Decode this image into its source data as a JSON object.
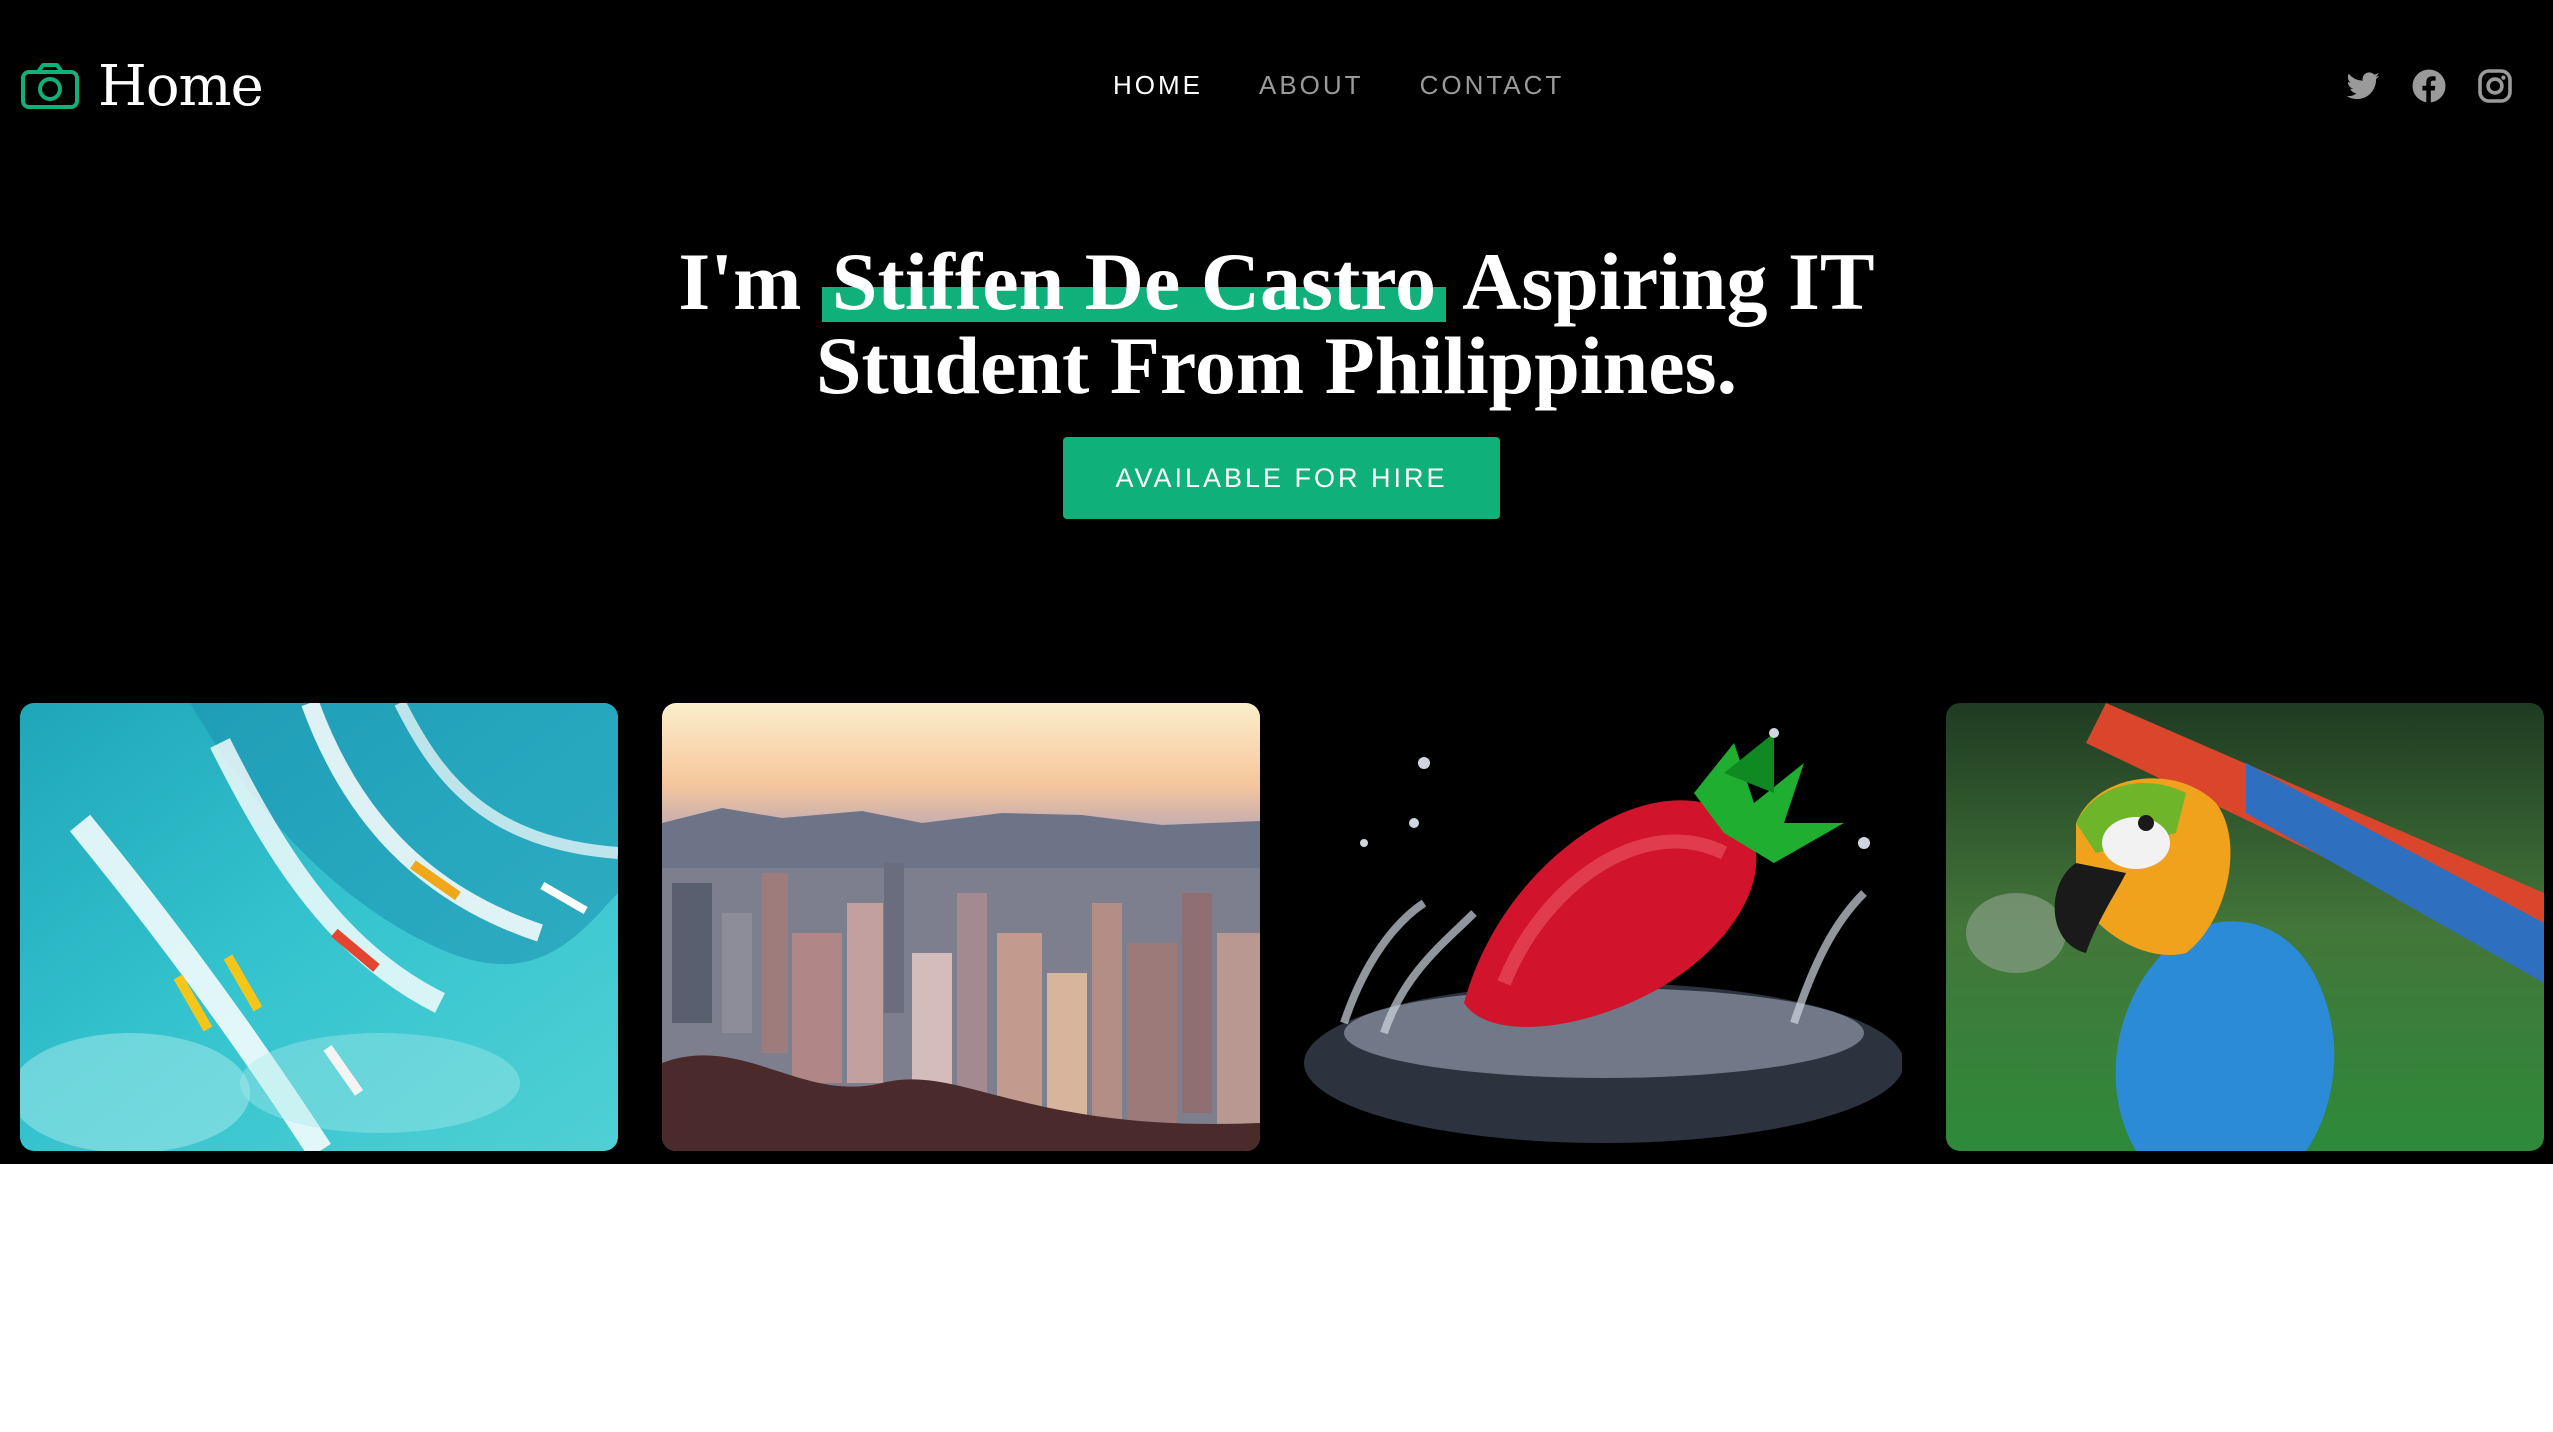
{
  "brand": {
    "title": "Home",
    "icon": "camera-icon",
    "accent": "#10b07a"
  },
  "nav": {
    "items": [
      {
        "label": "HOME",
        "active": true
      },
      {
        "label": "ABOUT",
        "active": false
      },
      {
        "label": "CONTACT",
        "active": false
      }
    ]
  },
  "social": {
    "icons": [
      "twitter-icon",
      "facebook-icon",
      "instagram-icon"
    ]
  },
  "hero": {
    "prefix": "I'm ",
    "name": "Stiffen De Castro",
    "line1_rest": "Aspiring IT",
    "line2": "Student From Philippines.",
    "cta_label": "AVAILABLE FOR HIRE"
  },
  "gallery": {
    "items": [
      {
        "subject": "surfers on ocean wave"
      },
      {
        "subject": "city skyline at sunset"
      },
      {
        "subject": "strawberry splashing in water"
      },
      {
        "subject": "macaw parrot"
      }
    ]
  },
  "colors": {
    "background": "#000000",
    "accent": "#10b07a",
    "nav_inactive": "#9a9a9a"
  }
}
